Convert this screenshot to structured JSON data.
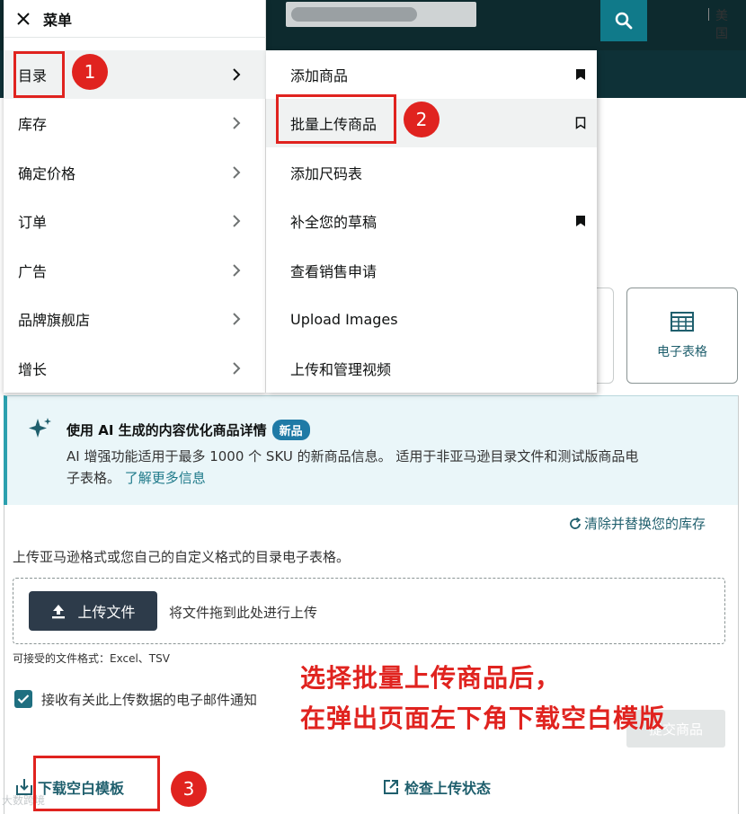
{
  "header": {
    "region_label": "美国",
    "search_icon": "search-icon"
  },
  "menu": {
    "title": "菜单",
    "close_icon": "close-icon",
    "items": [
      {
        "label": "目录"
      },
      {
        "label": "库存"
      },
      {
        "label": "确定价格"
      },
      {
        "label": "订单"
      },
      {
        "label": "广告"
      },
      {
        "label": "品牌旗舰店"
      },
      {
        "label": "增长"
      }
    ]
  },
  "submenu": {
    "items": [
      {
        "label": "添加商品",
        "bookmark": "filled"
      },
      {
        "label": "批量上传商品",
        "bookmark": "outline"
      },
      {
        "label": "添加尺码表",
        "bookmark": "none"
      },
      {
        "label": "补全您的草稿",
        "bookmark": "filled"
      },
      {
        "label": "查看销售申请",
        "bookmark": "none"
      },
      {
        "label": "Upload Images",
        "bookmark": "none"
      },
      {
        "label": "上传和管理视频",
        "bookmark": "none"
      }
    ]
  },
  "annotations": {
    "step1": "1",
    "step2": "2",
    "step3": "3",
    "callout_line1": "选择批量上传商品后，",
    "callout_line2": "在弹出页面左下角下载空白模版"
  },
  "spreadsheet_card": {
    "label": "电子表格",
    "icon": "table-icon"
  },
  "ai_banner": {
    "title": "使用 AI 生成的内容优化商品详情",
    "badge": "新品",
    "desc_line1": "AI 增强功能适用于最多 1000 个 SKU 的新商品信息。 适用于非亚马逊目录文件和测试版商品电",
    "desc_line2": "子表格。",
    "link": "了解更多信息"
  },
  "upload": {
    "clear_link": "清除并替换您的库存",
    "description": "上传亚马逊格式或您自己的自定义格式的目录电子表格。",
    "upload_button": "上传文件",
    "drop_text": "将文件拖到此处进行上传",
    "formats": "可接受的文件格式：Excel、TSV",
    "email_checkbox_label": "接收有关此上传数据的电子邮件通知",
    "email_checkbox_checked": true,
    "submit_button": "提交商品"
  },
  "footer": {
    "download_template": "下载空白模板",
    "check_status": "检查上传状态"
  },
  "watermark": "大数跨境",
  "colors": {
    "header_dark": "#0d2a2e",
    "accent_teal": "#107a8a",
    "annotation_red": "#e0231f",
    "link": "#1f5f6d"
  }
}
